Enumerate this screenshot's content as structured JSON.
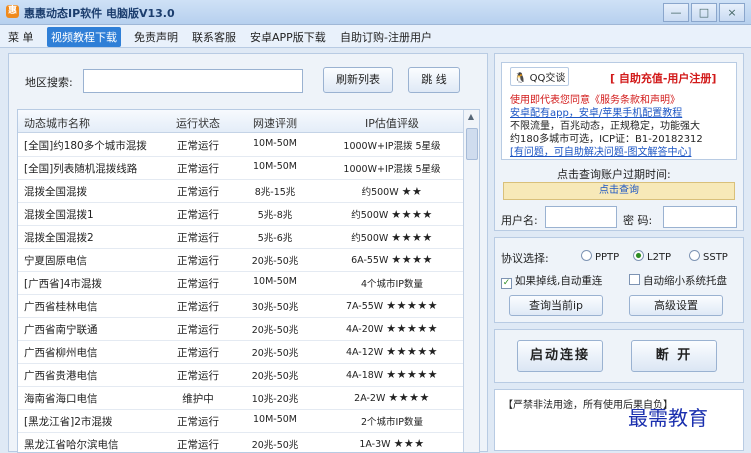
{
  "window": {
    "title": "惠惠动态IP软件 电脑版V13.0",
    "logo": "惠",
    "buttons": [
      "—",
      "□",
      "×"
    ]
  },
  "menu": [
    "菜 单",
    "视频教程下载",
    "免责声明",
    "联系客服",
    "安卓APP版下载",
    "自助订购-注册用户"
  ],
  "search": {
    "label": "地区搜索:",
    "value": "",
    "refresh_label": "刷新列表",
    "jump_label": "跳 线"
  },
  "table": {
    "headers": [
      "动态城市名称",
      "运行状态",
      "网速评测",
      "IP估值评级"
    ],
    "rows": [
      {
        "name": "[全国]约180多个城市混拨",
        "status": "正常运行",
        "speed": "10M-50M",
        "ip": "1000W+IP混拨",
        "rating": "5星级"
      },
      {
        "name": "[全国]列表随机混拨线路",
        "status": "正常运行",
        "speed": "10M-50M",
        "ip": "1000W+IP混拨",
        "rating": "5星级"
      },
      {
        "name": "混拨全国混拨",
        "status": "正常运行",
        "speed": "8兆-15兆",
        "ip": "约500W",
        "rating": "★★"
      },
      {
        "name": "混拨全国混拨1",
        "status": "正常运行",
        "speed": "5兆-8兆",
        "ip": "约500W",
        "rating": "★★★★"
      },
      {
        "name": "混拨全国混拨2",
        "status": "正常运行",
        "speed": "5兆-6兆",
        "ip": "约500W",
        "rating": "★★★★"
      },
      {
        "name": "宁夏固原电信",
        "status": "正常运行",
        "speed": "20兆-50兆",
        "ip": "6A-55W",
        "rating": "★★★★"
      },
      {
        "name": "[广西省]4市混拨",
        "status": "正常运行",
        "speed": "10M-50M",
        "ip": "4个城市IP数量",
        "rating": ""
      },
      {
        "name": "广西省桂林电信",
        "status": "正常运行",
        "speed": "30兆-50兆",
        "ip": "7A-55W",
        "rating": "★★★★★"
      },
      {
        "name": "广西省南宁联通",
        "status": "正常运行",
        "speed": "20兆-50兆",
        "ip": "4A-20W",
        "rating": "★★★★★"
      },
      {
        "name": "广西省柳州电信",
        "status": "正常运行",
        "speed": "20兆-50兆",
        "ip": "4A-12W",
        "rating": "★★★★★"
      },
      {
        "name": "广西省贵港电信",
        "status": "正常运行",
        "speed": "20兆-50兆",
        "ip": "4A-18W",
        "rating": "★★★★★"
      },
      {
        "name": "海南省海口电信",
        "status": "维护中",
        "speed": "10兆-20兆",
        "ip": "2A-2W",
        "rating": "★★★★"
      },
      {
        "name": "[黑龙江省]2市混拨",
        "status": "正常运行",
        "speed": "10M-50M",
        "ip": "2个城市IP数量",
        "rating": ""
      },
      {
        "name": "黑龙江省哈尔滨电信",
        "status": "正常运行",
        "speed": "20兆-50兆",
        "ip": "1A-3W",
        "rating": "★★★"
      }
    ]
  },
  "notice": {
    "qq_label": "QQ交谈",
    "recharge": "[ 自助充值-用户注册]",
    "line1": "使用即代表您同意《服务条款和声明》",
    "line2": "安卓配有app，安卓/苹果手机配置教程",
    "line3": "不限流量，百兆动态，正规稳定，功能强大",
    "line4": "约180多城市可选，ICP证：B1-20182312",
    "line5": "[有问题，可自助解决问题-图文解答中心]"
  },
  "account": {
    "expire_label": "点击查询账户过期时间:",
    "query_label": "点击查询",
    "username_label": "用户名:",
    "username_value": "",
    "password_label": "密 码:",
    "password_value": ""
  },
  "protocol": {
    "label": "协议选择:",
    "options": [
      "PPTP",
      "L2TP",
      "SSTP"
    ],
    "selected": "L2TP",
    "reconnect_label": "如果掉线,自动重连",
    "reconnect_checked": true,
    "minimize_label": "自动缩小系统托盘",
    "minimize_checked": false,
    "query_ip_label": "查询当前ip",
    "advanced_label": "高级设置"
  },
  "actions": {
    "connect_label": "启动连接",
    "disconnect_label": "断 开"
  },
  "log": {
    "text": "【严禁非法用途，所有使用后果自负】"
  },
  "watermark": "最需教育"
}
